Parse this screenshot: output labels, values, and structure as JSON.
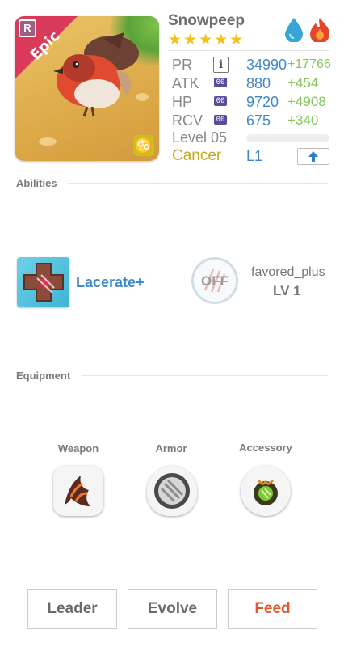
{
  "creature": {
    "name": "Snowpeep",
    "rarity": "Epic",
    "rarity_badge": "R",
    "stars": "★★★★★",
    "star_count": 5,
    "elements": [
      "water-drop-icon",
      "fire-icon"
    ],
    "zodiac_symbol": "♋"
  },
  "stats": [
    {
      "label": "PR",
      "value": "34990",
      "bonus": "+17766",
      "icon": "info-icon",
      "icon_text": "i"
    },
    {
      "label": "ATK",
      "value": "880",
      "bonus": "+454",
      "icon": "stat-icon",
      "icon_text": "00"
    },
    {
      "label": "HP",
      "value": "9720",
      "bonus": "+4908",
      "icon": "stat-icon",
      "icon_text": "00"
    },
    {
      "label": "RCV",
      "value": "675",
      "bonus": "+340",
      "icon": "stat-icon",
      "icon_text": "00"
    }
  ],
  "level": {
    "label": "Level 05",
    "progress": 0
  },
  "zodiac": "Cancer",
  "limit": "L1",
  "abilities": {
    "title": "Abilities",
    "skill_name": "Lacerate+",
    "toggle_text": "OFF",
    "favored_label": "favored_plus",
    "favored_level": "LV 1"
  },
  "equipment": {
    "title": "Equipment",
    "slots": [
      {
        "label": "Weapon",
        "icon": "weapon-claw-icon"
      },
      {
        "label": "Armor",
        "icon": "armor-shield-icon"
      },
      {
        "label": "Accessory",
        "icon": "accessory-gem-icon"
      }
    ]
  },
  "actions": {
    "leader": "Leader",
    "evolve": "Evolve",
    "feed": "Feed"
  },
  "colors": {
    "accent_blue": "#3f88c9",
    "bonus_green": "#86c55a",
    "epic_red": "#d93a5a",
    "star_gold": "#f2c21a",
    "zodiac_gold": "#c8a81a",
    "feed_orange": "#e0562a"
  }
}
